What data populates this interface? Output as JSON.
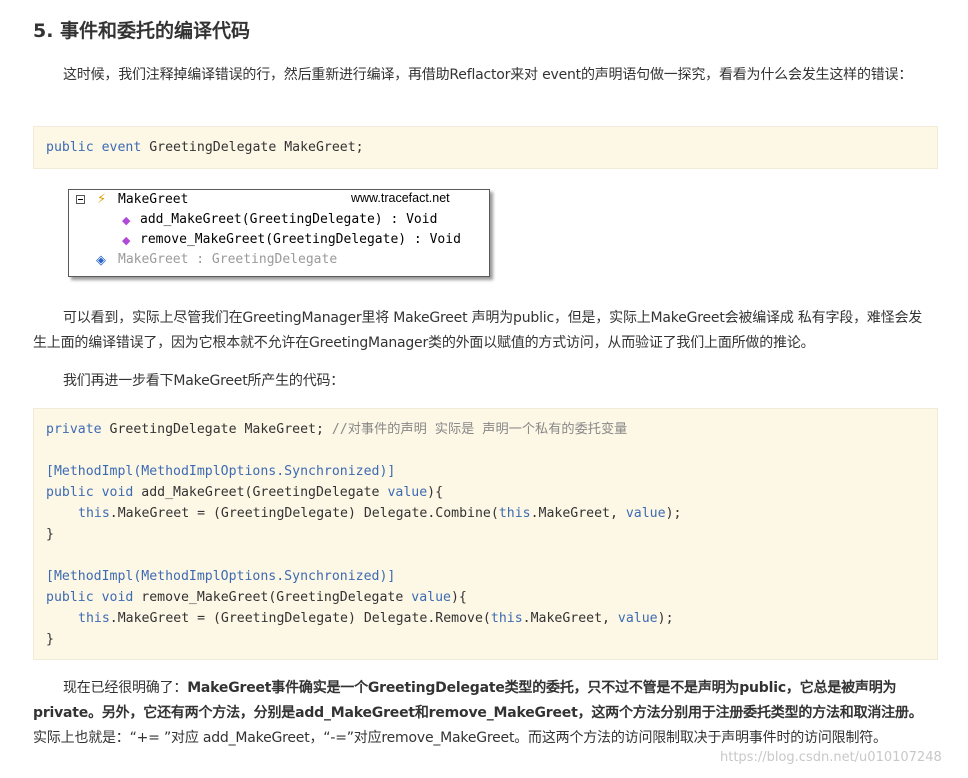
{
  "heading": "5. 事件和委托的编译代码",
  "p1": "这时候，我们注释掉编译错误的行，然后重新进行编译，再借助Reflactor来对 event的声明语句做一探究，看看为什么会发生这样的错误：",
  "code1": {
    "kw1": "public",
    "kw2": "event",
    "rest": " GreetingDelegate MakeGreet;"
  },
  "reflector": {
    "root": "MakeGreet",
    "site": "www.tracefact.net",
    "add": "add_MakeGreet(GreetingDelegate) : Void",
    "remove": "remove_MakeGreet(GreetingDelegate) : Void",
    "field": "MakeGreet : GreetingDelegate",
    "icons": [
      "minus-box-icon",
      "event-bolt-icon",
      "method-icon",
      "field-icon"
    ]
  },
  "p2": "可以看到，实际上尽管我们在GreetingManager里将 MakeGreet 声明为public，但是，实际上MakeGreet会被编译成 私有字段，难怪会发生上面的编译错误了，因为它根本就不允许在GreetingManager类的外面以赋值的方式访问，从而验证了我们上面所做的推论。",
  "p3": "我们再进一步看下MakeGreet所产生的代码：",
  "code2": {
    "l1_kw": "private",
    "l1_rest": " GreetingDelegate MakeGreet; ",
    "l1_cm": "//对事件的声明 实际是 声明一个私有的委托变量",
    "attr1": "[MethodImpl(MethodImplOptions.Synchronized)]",
    "l4_kw1": "public",
    "l4_kw2": "void",
    "l4_mid": " add_MakeGreet(GreetingDelegate ",
    "l4_val": "value",
    "l4_end": "){",
    "l5_this": "this",
    "l5_mid": ".MakeGreet = (GreetingDelegate) Delegate.Combine(",
    "l5_this2": "this",
    "l5_mid2": ".MakeGreet, ",
    "l5_val": "value",
    "l5_end": ");",
    "brace": "}",
    "attr2": "[MethodImpl(MethodImplOptions.Synchronized)]",
    "l9_kw1": "public",
    "l9_kw2": "void",
    "l9_mid": " remove_MakeGreet(GreetingDelegate ",
    "l9_val": "value",
    "l9_end": "){",
    "l10_this": "this",
    "l10_mid": ".MakeGreet = (GreetingDelegate) Delegate.Remove(",
    "l10_this2": "this",
    "l10_mid2": ".MakeGreet, ",
    "l10_val": "value",
    "l10_end": ");",
    "brace2": "}"
  },
  "p4": {
    "lead": "现在已经很明确了：",
    "bold": "MakeGreet事件确实是一个GreetingDelegate类型的委托，只不过不管是不是声明为public，它总是被声明为private。另外，它还有两个方法，分别是add_MakeGreet和remove_MakeGreet，这两个方法分别用于注册委托类型的方法和取消注册。",
    "tail": "实际上也就是：“+= ”对应 add_MakeGreet，“-=”对应remove_MakeGreet。而这两个方法的访问限制取决于声明事件时的访问限制符。"
  },
  "watermark": "https://blog.csdn.net/u010107248"
}
